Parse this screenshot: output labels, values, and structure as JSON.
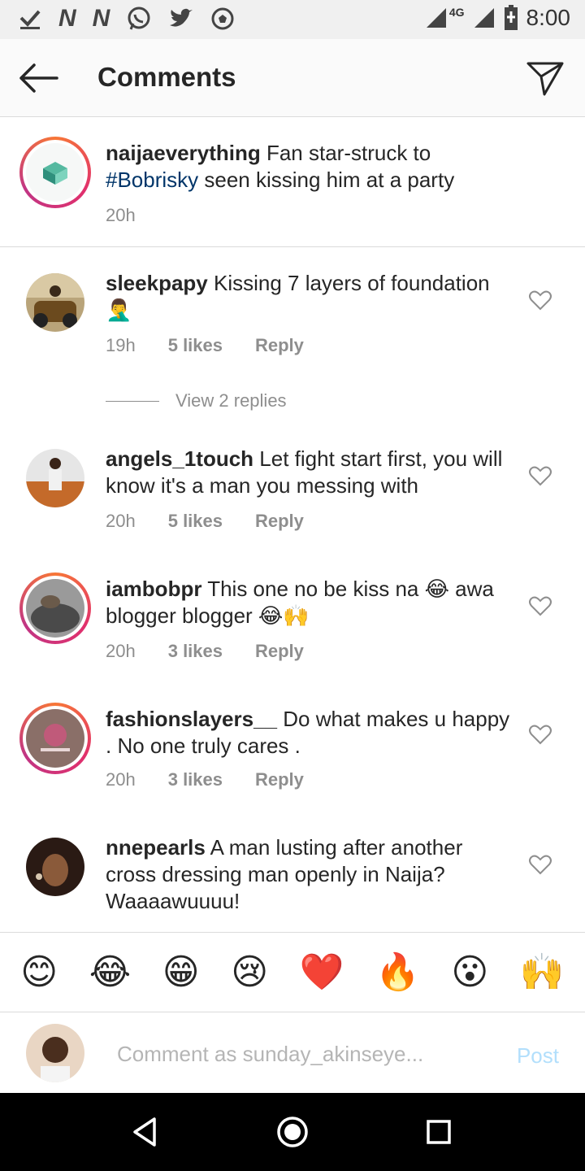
{
  "status_bar": {
    "icons": [
      "check-download-icon",
      "n-notification-icon",
      "n-notification-icon",
      "whatsapp-icon",
      "twitter-icon",
      "soccer-icon"
    ],
    "network": "4G",
    "time": "8:00"
  },
  "header": {
    "title": "Comments"
  },
  "caption": {
    "username": "naijaeverything",
    "text_before": " Fan star-struck to",
    "hashtag": "#Bobrisky",
    "text_after": " seen kissing him at a party",
    "time": "20h"
  },
  "comments": [
    {
      "username": "sleekpapy",
      "text": " Kissing 7 layers of foundation 🤦‍♂️",
      "time": "19h",
      "likes": "5 likes",
      "reply": "Reply",
      "view_replies": "View 2 replies"
    },
    {
      "username": "angels_1touch",
      "text": " Let fight start first, you will know it's a man you messing with",
      "time": "20h",
      "likes": "5 likes",
      "reply": "Reply"
    },
    {
      "username": "iambobpr",
      "text": " This one no be kiss na 😂 awa blogger blogger 😂🙌",
      "time": "20h",
      "likes": "3 likes",
      "reply": "Reply"
    },
    {
      "username": "fashionslayers__",
      "text": " Do what  makes u happy . No one truly cares .",
      "time": "20h",
      "likes": "3 likes",
      "reply": "Reply"
    },
    {
      "username": "nnepearls",
      "text": " A man lusting after another cross dressing man openly in Naija? Waaaawuuuu!"
    }
  ],
  "emoji_bar": [
    "😊",
    "😂",
    "😁",
    "😢",
    "❤️",
    "🔥",
    "😮",
    "🙌"
  ],
  "composer": {
    "placeholder": "Comment as sunday_akinseye...",
    "post_label": "Post"
  },
  "colors": {
    "hashtag": "#003569",
    "muted": "#8e8e8e",
    "post_disabled": "#b2dffc"
  }
}
